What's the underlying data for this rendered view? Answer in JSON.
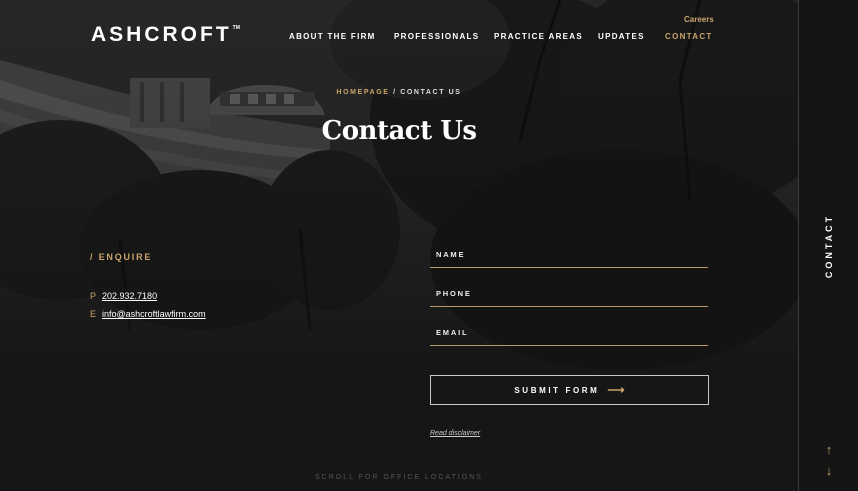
{
  "brand": {
    "name": "ASHCROFT",
    "tm": "TM"
  },
  "header": {
    "careers": "Careers",
    "nav": [
      {
        "label": "ABOUT THE FIRM",
        "active": false
      },
      {
        "label": "PROFESSIONALS",
        "active": false
      },
      {
        "label": "PRACTICE AREAS",
        "active": false
      },
      {
        "label": "UPDATES",
        "active": false
      },
      {
        "label": "CONTACT",
        "active": true
      }
    ]
  },
  "breadcrumb": {
    "home": "HOMEPAGE",
    "separator": "/",
    "current": "CONTACT US"
  },
  "page_title": "Contact Us",
  "enquire": {
    "heading": "/ ENQUIRE",
    "phone_key": "P",
    "phone": "202.932.7180",
    "email_key": "E",
    "email": "info@ashcroftlawfirm.com"
  },
  "form": {
    "name_label": "NAME",
    "phone_label": "PHONE",
    "email_label": "EMAIL",
    "submit_label": "SUBMIT FORM",
    "submit_arrow": "⟶",
    "disclaimer": "Read disclaimer"
  },
  "rail": {
    "label": "CONTACT",
    "up_icon": "arrow-up-icon",
    "down_icon": "arrow-down-icon",
    "up_glyph": "↑",
    "down_glyph": "↓"
  },
  "scroll_hint": "SCROLL FOR OFFICE LOCATIONS",
  "colors": {
    "accent": "#c9a46a",
    "background": "#161616"
  }
}
